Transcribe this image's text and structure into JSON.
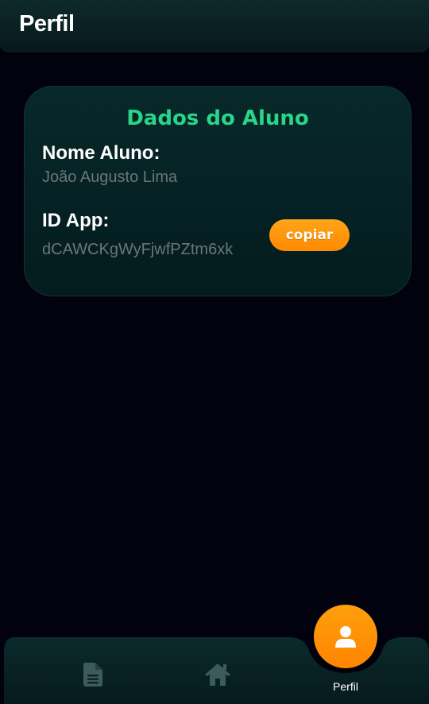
{
  "header": {
    "title": "Perfil"
  },
  "card": {
    "title": "Dados do Aluno",
    "name_label": "Nome Aluno:",
    "name_value": "João Augusto Lima",
    "id_label": "ID App:",
    "id_value": "dCAWCKgWyFjwfPZtm6xk",
    "copy_button": "copiar"
  },
  "bottom_nav": {
    "items": [
      {
        "icon": "document-icon",
        "label": ""
      },
      {
        "icon": "home-icon",
        "label": ""
      },
      {
        "icon": "user-icon",
        "label": "Perfil",
        "active": true
      }
    ]
  },
  "colors": {
    "background": "#01020d",
    "accent_green": "#2ad488",
    "accent_orange": "#ff8a00",
    "card_bg": "#062426",
    "nav_icon": "#3d5c59"
  }
}
